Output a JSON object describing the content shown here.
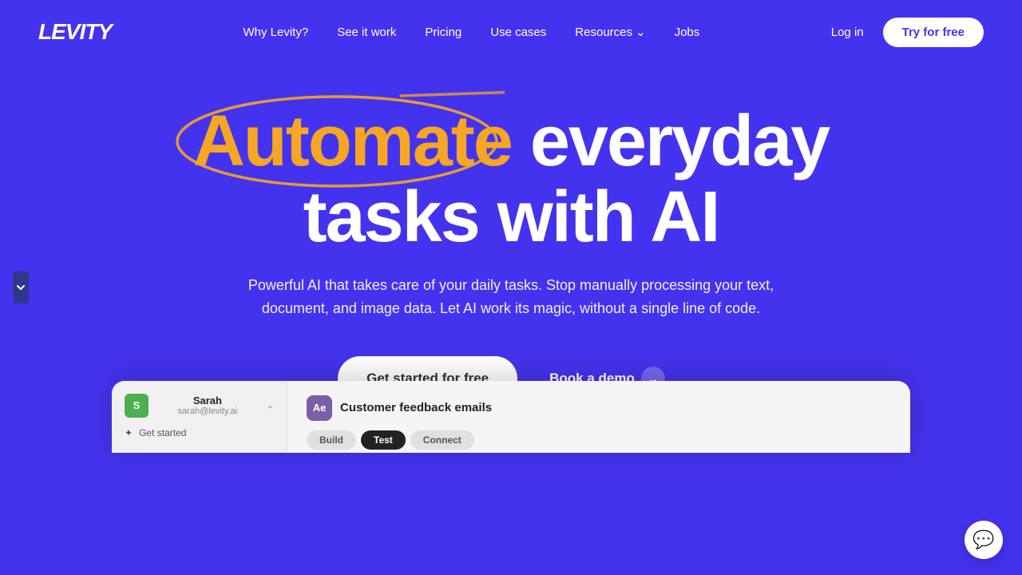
{
  "brand": {
    "name": "LEVITY"
  },
  "nav": {
    "links": [
      {
        "id": "why-levity",
        "label": "Why Levity?"
      },
      {
        "id": "see-it-work",
        "label": "See it work"
      },
      {
        "id": "pricing",
        "label": "Pricing"
      },
      {
        "id": "use-cases",
        "label": "Use cases"
      },
      {
        "id": "resources",
        "label": "Resources"
      },
      {
        "id": "jobs",
        "label": "Jobs"
      }
    ],
    "login_label": "Log in",
    "try_label": "Try for free"
  },
  "hero": {
    "heading_word": "Automate",
    "heading_rest": " everyday",
    "heading_line2": "tasks with AI",
    "subtext": "Powerful AI that takes care of your daily tasks. Stop manually processing your text, document, and image data. Let AI work its magic, without a single line of code.",
    "cta_primary": "Get started for free",
    "cta_secondary": "Book a demo"
  },
  "preview": {
    "user_initial": "S",
    "user_name": "Sarah",
    "user_email": "sarah@levity.ai",
    "get_started_label": "Get started",
    "workflow_title": "Customer feedback emails",
    "workflow_icon_text": "Ae",
    "tab_build": "Build",
    "tab_test": "Test",
    "tab_connect": "Connect"
  },
  "colors": {
    "bg": "#4433ee",
    "automate": "#f5a623",
    "white": "#ffffff"
  }
}
